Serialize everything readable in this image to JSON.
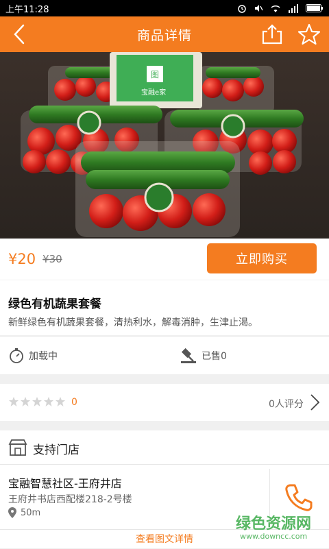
{
  "status_bar": {
    "time": "上午11:28"
  },
  "header": {
    "title": "商品详情"
  },
  "hero": {
    "sign_text": "宝融e家"
  },
  "price": {
    "current": "¥20",
    "original": "¥30",
    "buy_label": "立即购买"
  },
  "product": {
    "name": "绿色有机蔬果套餐",
    "description": "新鲜绿色有机蔬果套餐，清热利水，解毒消肿，生津止渴。"
  },
  "stats": {
    "countdown": "加载中",
    "sold": "已售0"
  },
  "rating": {
    "score": "0",
    "count": "0人评分"
  },
  "store_section": {
    "title": "支持门店"
  },
  "store": {
    "name": "宝融智慧社区-王府井店",
    "address": "王府井书店西配楼218-2号楼",
    "distance": "50m"
  },
  "detail_link": "查看图文详情",
  "watermark": {
    "main": "绿色资源网",
    "url": "www.downcc.com"
  },
  "colors": {
    "accent": "#f47c20",
    "watermark": "#3cab4a"
  }
}
